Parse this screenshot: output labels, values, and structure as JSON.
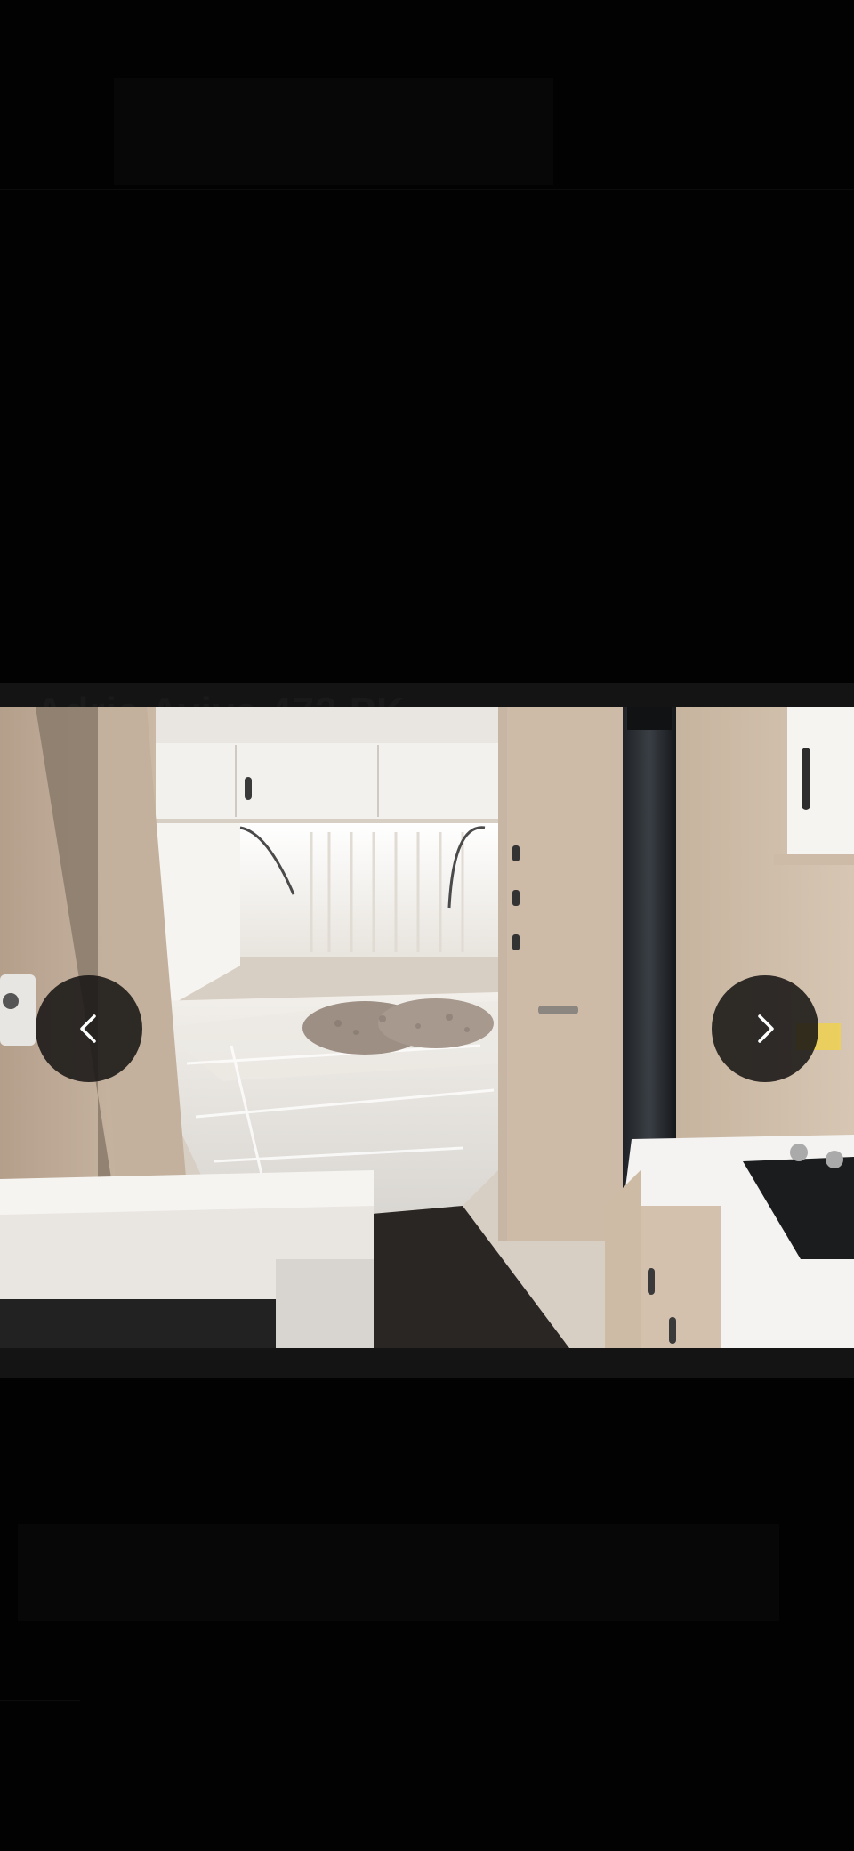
{
  "page": {
    "background_title": "Adria Aviva 472 PK"
  },
  "viewer": {
    "photo_alt": "Caravan interior with bed",
    "prev_icon": "chevron-left-icon",
    "next_icon": "chevron-right-icon"
  },
  "colors": {
    "backdrop": "#020202",
    "viewer_band": "#141414",
    "nav_button": "#181614",
    "chevron": "#ffffff"
  }
}
